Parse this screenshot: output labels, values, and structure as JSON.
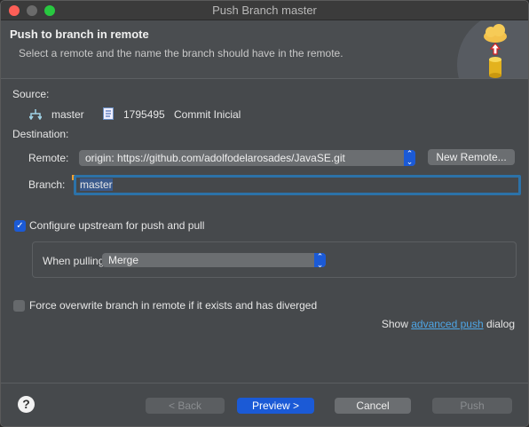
{
  "window": {
    "title": "Push Branch master"
  },
  "header": {
    "title": "Push to branch in remote",
    "description": "Select a remote and the name the branch should have in the remote.",
    "icon": "push-to-cloud-icon"
  },
  "source": {
    "label": "Source:",
    "branch": "master",
    "commit_id": "1795495",
    "commit_message": "Commit Inicial"
  },
  "destination": {
    "label": "Destination:",
    "remote_label": "Remote:",
    "remote_value": "origin: https://github.com/adolfodelarosades/JavaSE.git",
    "new_remote_label": "New Remote...",
    "branch_label": "Branch:",
    "branch_value": "master"
  },
  "upstream": {
    "label": "Configure upstream for push and pull",
    "checked": true,
    "when_pulling_label": "When pulling:",
    "when_pulling_value": "Merge"
  },
  "force": {
    "label": "Force overwrite branch in remote if it exists and has diverged",
    "checked": false
  },
  "advanced": {
    "prefix": "Show",
    "link": "advanced push",
    "suffix": "dialog"
  },
  "buttons": {
    "help": "?",
    "back": "< Back",
    "preview": "Preview >",
    "cancel": "Cancel",
    "push": "Push"
  },
  "colors": {
    "accent": "#1b5ad6",
    "link": "#4ea6e6"
  }
}
